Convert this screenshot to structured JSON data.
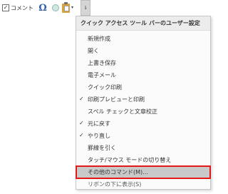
{
  "toolbar": {
    "comment_checkbox_checked": true,
    "comment_label": "コメント",
    "omega_glyph": "Ω",
    "customize_glyph": "⇂",
    "paste_arrow": "▾"
  },
  "menu": {
    "header": "クイック アクセス ツール バーのユーザー設定",
    "items": [
      {
        "label": "新規作成",
        "checked": false
      },
      {
        "label": "開く",
        "checked": false
      },
      {
        "label": "上書き保存",
        "checked": false
      },
      {
        "label": "電子メール",
        "checked": false
      },
      {
        "label": "クイック印刷",
        "checked": false
      },
      {
        "label": "印刷プレビューと印刷",
        "checked": true
      },
      {
        "label": "スペル チェックと文章校正",
        "checked": false
      },
      {
        "label": "元に戻す",
        "checked": true
      },
      {
        "label": "やり直し",
        "checked": true
      },
      {
        "label": "罫線を引く",
        "checked": false
      },
      {
        "label": "タッチ/マウス モードの切り替え",
        "checked": false
      },
      {
        "label": "その他のコマンド(M)...",
        "checked": false,
        "highlighted": true
      },
      {
        "label": "リボンの下に表示(S)",
        "checked": false
      }
    ],
    "check_glyph": "✓",
    "highlight_outline_color": "#e11919"
  }
}
